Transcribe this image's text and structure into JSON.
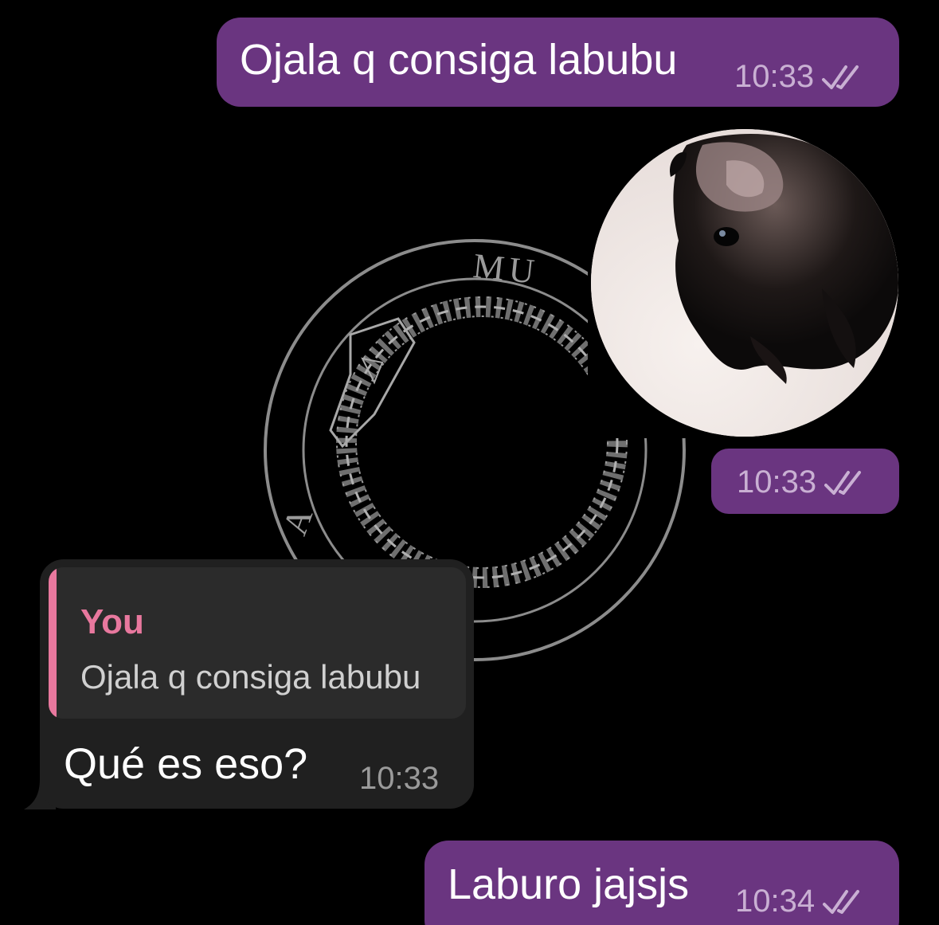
{
  "messages": [
    {
      "direction": "outgoing",
      "type": "text",
      "text": "Ojala q consiga labubu",
      "time": "10:33",
      "status_icon": "double-check-icon"
    },
    {
      "direction": "outgoing",
      "type": "video-message",
      "preview": "round video circle showing a dark furry creature close-up",
      "time": "10:33",
      "status_icon": "double-check-icon"
    },
    {
      "direction": "incoming",
      "type": "reply",
      "reply_to": {
        "author": "You",
        "text": "Ojala q consiga labubu"
      },
      "text": "Qué es eso?",
      "time": "10:33"
    },
    {
      "direction": "outgoing",
      "type": "text",
      "text": "Laburo jajsjs",
      "time": "10:34",
      "status_icon": "double-check-icon"
    }
  ],
  "wallpaper": {
    "letters": [
      "MU",
      "A"
    ]
  },
  "colors": {
    "background": "#000000",
    "outgoing_bubble": "#6a3580",
    "incoming_bubble": "#202020",
    "reply_accent": "#e8789e",
    "outgoing_meta": "#c9b0d3",
    "incoming_meta": "#9a9a9a"
  }
}
